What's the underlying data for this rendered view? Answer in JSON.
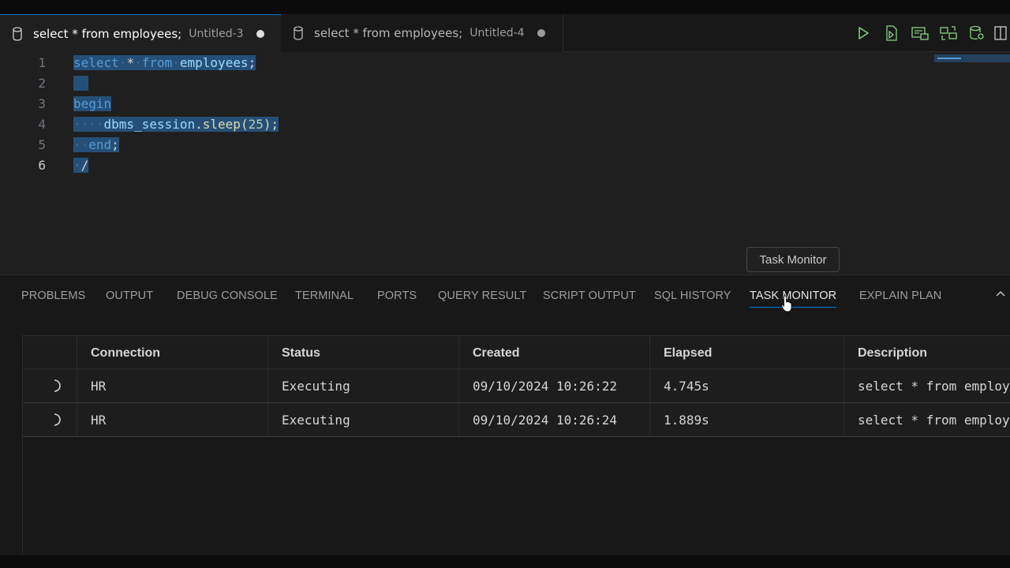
{
  "tabs": [
    {
      "title": "select * from employees;",
      "description": "Untitled-3",
      "active": true,
      "dirty": true
    },
    {
      "title": "select * from employees;",
      "description": "Untitled-4",
      "active": false,
      "dirty": true
    }
  ],
  "editor_actions": [
    "run-icon",
    "run-script-icon",
    "explain-icon",
    "compare-icon",
    "database-settings-icon",
    "split-editor-icon"
  ],
  "editor": {
    "lines": [
      {
        "number": "1",
        "text": "select * from employees;"
      },
      {
        "number": "2",
        "text": ""
      },
      {
        "number": "3",
        "text": "begin"
      },
      {
        "number": "4",
        "text": "dbms_session.sleep(25);"
      },
      {
        "number": "5",
        "text": "end;"
      },
      {
        "number": "6",
        "text": "/"
      }
    ],
    "tokens": {
      "l1_select": "select",
      "l1_star": "*",
      "l1_from": "from",
      "l1_table": "employees",
      "l1_semi": ";",
      "l3_begin": "begin",
      "l4_obj": "dbms_session",
      "l4_dot": ".",
      "l4_fn": "sleep",
      "l4_open": "(",
      "l4_num": "25",
      "l4_close": ");",
      "l5_end": "end",
      "l5_semi": ";",
      "l6_slash": "/"
    }
  },
  "tooltip": "Task Monitor",
  "panel": {
    "tabs": [
      "PROBLEMS",
      "OUTPUT",
      "DEBUG CONSOLE",
      "TERMINAL",
      "PORTS",
      "QUERY RESULT",
      "SCRIPT OUTPUT",
      "SQL HISTORY",
      "TASK MONITOR",
      "EXPLAIN PLAN"
    ],
    "active_tab": "TASK MONITOR"
  },
  "task_monitor": {
    "columns": [
      "Connection",
      "Status",
      "Created",
      "Elapsed",
      "Description"
    ],
    "rows": [
      {
        "connection": "HR",
        "status": "Executing",
        "created": "09/10/2024 10:26:22",
        "elapsed": "4.745s",
        "description": "select * from employ"
      },
      {
        "connection": "HR",
        "status": "Executing",
        "created": "09/10/2024 10:26:24",
        "elapsed": "1.889s",
        "description": "select * from employ"
      }
    ]
  },
  "colors": {
    "accent": "#0078d4",
    "selection": "#264f78",
    "keyword": "#569cd6",
    "function": "#dcdcaa",
    "number": "#b5cea8"
  }
}
